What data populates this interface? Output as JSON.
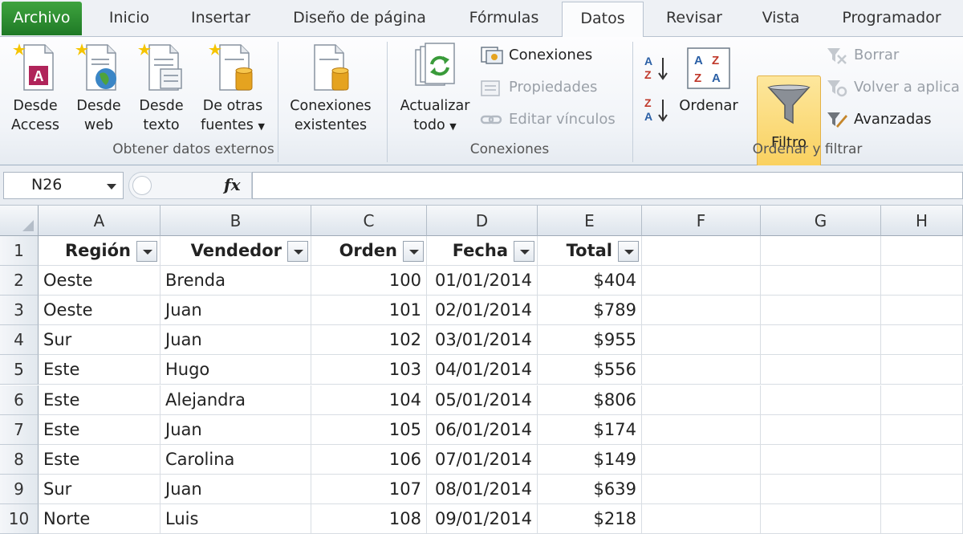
{
  "tabs": [
    "Archivo",
    "Inicio",
    "Insertar",
    "Diseño de página",
    "Fórmulas",
    "Datos",
    "Revisar",
    "Vista",
    "Programador"
  ],
  "active_tab": "Datos",
  "ribbon": {
    "external": {
      "access": [
        "Desde",
        "Access"
      ],
      "web": [
        "Desde",
        "web"
      ],
      "text": [
        "Desde",
        "texto"
      ],
      "other": [
        "De otras",
        "fuentes"
      ],
      "existing": [
        "Conexiones",
        "existentes"
      ],
      "label": "Obtener datos externos"
    },
    "connections": {
      "refresh": [
        "Actualizar",
        "todo"
      ],
      "conexiones": "Conexiones",
      "propiedades": "Propiedades",
      "editar": "Editar vínculos",
      "label": "Conexiones"
    },
    "sortfilter": {
      "ordenar": "Ordenar",
      "filtro": "Filtro",
      "borrar": "Borrar",
      "volver": "Volver a aplica",
      "avanzadas": "Avanzadas",
      "label": "Ordenar y filtrar"
    }
  },
  "formula_bar": {
    "name_box": "N26",
    "fx": "fx",
    "formula": ""
  },
  "sheet": {
    "columns": [
      "A",
      "B",
      "C",
      "D",
      "E",
      "F",
      "G",
      "H"
    ],
    "rows": [
      "1",
      "2",
      "3",
      "4",
      "5",
      "6",
      "7",
      "8",
      "9",
      "10"
    ],
    "headers": [
      "Región",
      "Vendedor",
      "Orden",
      "Fecha",
      "Total"
    ],
    "data": [
      [
        "Oeste",
        "Brenda",
        "100",
        "01/01/2014",
        "$404"
      ],
      [
        "Oeste",
        "Juan",
        "101",
        "02/01/2014",
        "$789"
      ],
      [
        "Sur",
        "Juan",
        "102",
        "03/01/2014",
        "$955"
      ],
      [
        "Este",
        "Hugo",
        "103",
        "04/01/2014",
        "$556"
      ],
      [
        "Este",
        "Alejandra",
        "104",
        "05/01/2014",
        "$806"
      ],
      [
        "Este",
        "Juan",
        "105",
        "06/01/2014",
        "$174"
      ],
      [
        "Este",
        "Carolina",
        "106",
        "07/01/2014",
        "$149"
      ],
      [
        "Sur",
        "Juan",
        "107",
        "08/01/2014",
        "$639"
      ],
      [
        "Norte",
        "Luis",
        "108",
        "09/01/2014",
        "$218"
      ]
    ]
  },
  "colors": {
    "file_tab": "#2f8f33",
    "filter_highlight": "#f9cf5b",
    "grid_line": "#d8dde3"
  }
}
